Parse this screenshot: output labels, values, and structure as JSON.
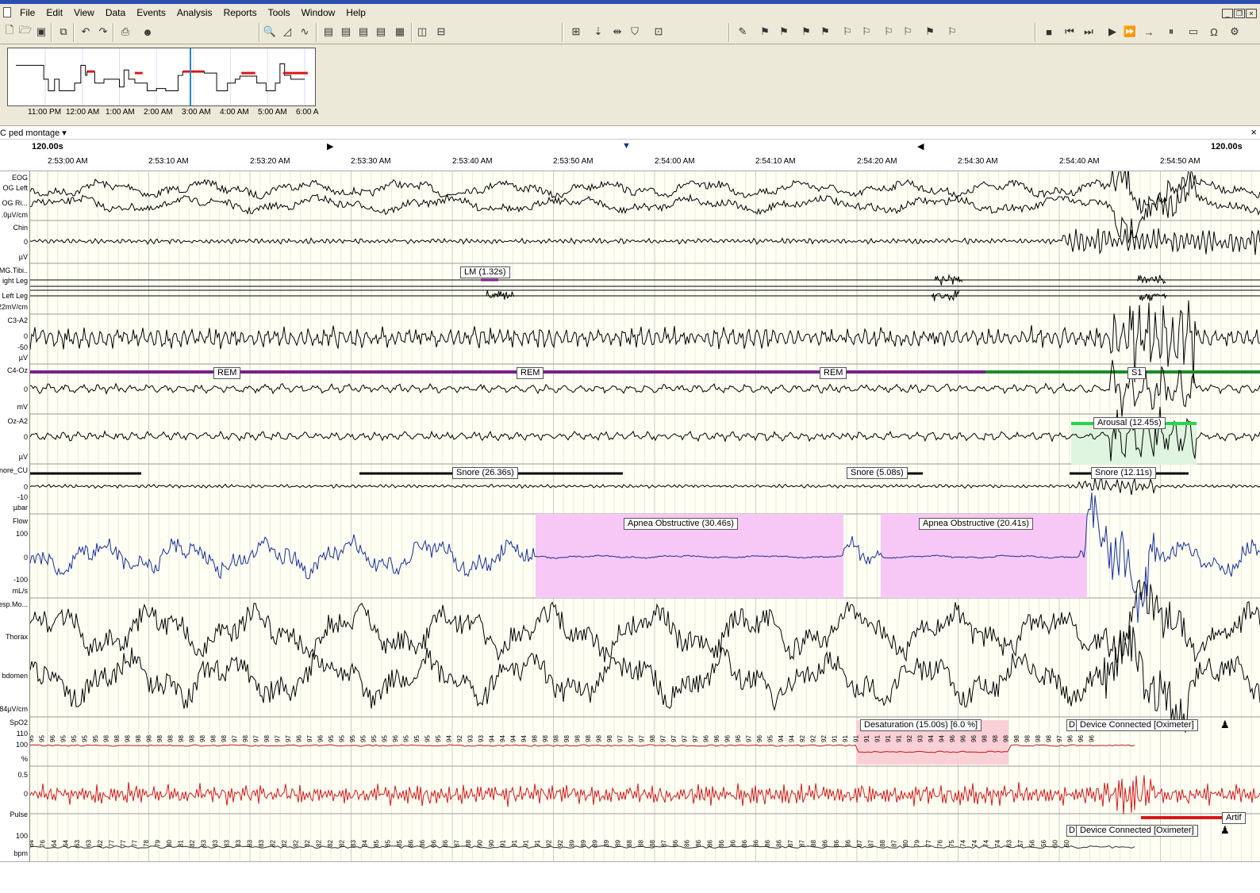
{
  "menu": [
    "File",
    "Edit",
    "View",
    "Data",
    "Events",
    "Analysis",
    "Reports",
    "Tools",
    "Window",
    "Help"
  ],
  "hypnogram": {
    "time_labels": [
      "11:00 PM",
      "12:00 AM",
      "1:00 AM",
      "2:00 AM",
      "3:00 AM",
      "4:00 AM",
      "5:00 AM",
      "6:00 A"
    ]
  },
  "montage": {
    "name": "C ped montage"
  },
  "timeline": {
    "window_left": "120.00s",
    "window_right": "120.00s",
    "ticks": [
      "2:53:00 AM",
      "2:53:10 AM",
      "2:53:20 AM",
      "2:53:30 AM",
      "2:53:40 AM",
      "2:53:50 AM",
      "2:54:00 AM",
      "2:54:10 AM",
      "2:54:20 AM",
      "2:54:30 AM",
      "2:54:40 AM",
      "2:54:50 AM"
    ]
  },
  "channels": {
    "eog": {
      "group": "EOG",
      "left": "OG Left",
      "right": "OG Ri...",
      "scale": ".0µV/cm"
    },
    "chin": {
      "name": "Chin",
      "zero": "0",
      "unit": "µV"
    },
    "emg": {
      "group": "MG.Tibi..",
      "right": "ight Leg",
      "left": "Left Leg",
      "scale": "22mV/cm"
    },
    "c3": {
      "name": "C3-A2",
      "zero": "0",
      "neg": "-50",
      "unit": "µV"
    },
    "c4": {
      "name": "C4-Oz",
      "zero": "0",
      "unit": "mV"
    },
    "oz": {
      "name": "Oz-A2",
      "zero": "0",
      "unit": "µV"
    },
    "snore": {
      "name": "nore_CU",
      "zero": "0",
      "neg": "-10",
      "unit": "µbar"
    },
    "flow": {
      "name": "Flow",
      "pos": "100",
      "zero": "0",
      "neg": "-100",
      "unit": "mL/s"
    },
    "resp": {
      "group": "esp.Mo...",
      "thorax": "Thorax",
      "abdomen": "bdomen",
      "scale": "84µV/cm"
    },
    "spo2": {
      "name": "SpO2",
      "top": "110",
      "mid": "100",
      "unit": "%"
    },
    "pleth": {
      "top": "0.5",
      "zero": "0"
    },
    "pulse": {
      "name": "Pulse",
      "mid": "100",
      "unit": "bpm"
    }
  },
  "events": {
    "lm": "LM (1.32s)",
    "rem1": "REM",
    "rem2": "REM",
    "rem3": "REM",
    "s1": "S1",
    "arousal": "Arousal (12.45s)",
    "snore1": "Snore (26.36s)",
    "snore2": "Snore (5.08s)",
    "snore3": "Snore (12.11s)",
    "apnea1": "Apnea Obstructive (30.46s)",
    "apnea2": "Apnea Obstructive (20.41s)",
    "desat": "Desaturation (15.00s) [6.0 %]",
    "device1": "Device Connected [Oximeter]",
    "device2": "Device Connected [Oximeter]",
    "artifact": "Artif",
    "d1": "D",
    "d2": "D"
  },
  "spo2_values": [
    95,
    95,
    96,
    95,
    95,
    95,
    95,
    98,
    98,
    98,
    98,
    98,
    98,
    98,
    98,
    98,
    98,
    98,
    98,
    97,
    98,
    97,
    98,
    97,
    97,
    96,
    97,
    96,
    95,
    95,
    95,
    95,
    95,
    95,
    96,
    95,
    95,
    95,
    95,
    94,
    92,
    93,
    93,
    94,
    94,
    94,
    94,
    98,
    98,
    98,
    98,
    98,
    98,
    98,
    98,
    97,
    97,
    97,
    98,
    97,
    97,
    97,
    97,
    96,
    96,
    96,
    96,
    97,
    96,
    95,
    94,
    94,
    92,
    92,
    92,
    91,
    91,
    91,
    91,
    91,
    91,
    91,
    92,
    93,
    94,
    94,
    96,
    96,
    96,
    98,
    98,
    98,
    98,
    98,
    98,
    98,
    97,
    96,
    96,
    96
  ],
  "pulse_values": [
    84,
    76,
    64,
    64,
    63,
    63,
    62,
    77,
    77,
    77,
    78,
    79,
    80,
    81,
    82,
    83,
    83,
    83,
    83,
    83,
    83,
    82,
    82,
    82,
    82,
    82,
    82,
    82,
    83,
    84,
    85,
    85,
    85,
    86,
    86,
    86,
    86,
    87,
    88,
    90,
    90,
    91,
    91,
    91,
    91,
    92,
    92,
    89,
    89,
    89,
    89,
    89,
    88,
    88,
    88,
    87,
    86,
    86,
    86,
    86,
    86,
    86,
    86,
    86,
    86,
    86,
    87,
    87,
    88,
    86,
    86,
    86,
    87,
    87,
    88,
    87,
    80,
    79,
    77,
    76,
    75,
    74,
    74,
    74,
    74,
    63,
    57,
    56,
    56,
    60,
    60
  ],
  "colors": {
    "rem": "#7a1f8a",
    "s1": "#1e8a2a",
    "apnea": "#f7c8f5",
    "desat": "#f9d0d6",
    "arousal": "#27d64a",
    "flow": "#1a2f9a",
    "pleth": "#d81818",
    "spo2": "#c01818"
  }
}
